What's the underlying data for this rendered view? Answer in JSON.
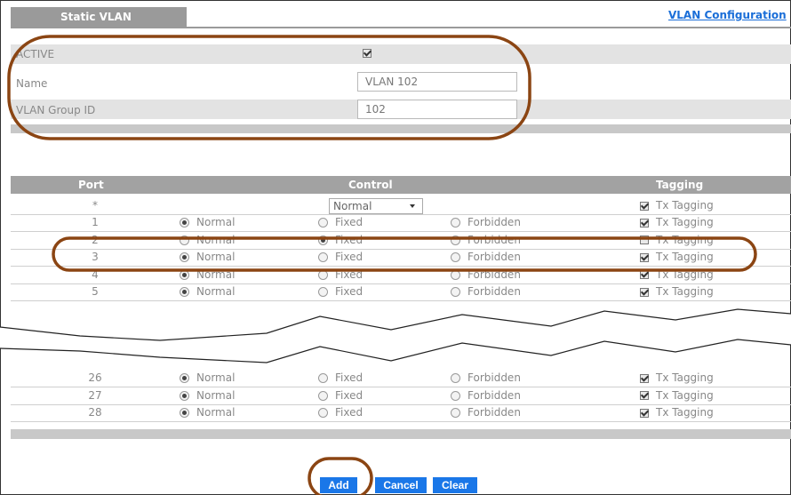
{
  "header": {
    "tab_title": "Static VLAN",
    "link_text": "VLAN Configuration"
  },
  "form": {
    "active_label": "ACTIVE",
    "active_checked": true,
    "name_label": "Name",
    "name_value": "VLAN 102",
    "group_id_label": "VLAN Group ID",
    "group_id_value": "102"
  },
  "table": {
    "col_port": "Port",
    "col_control": "Control",
    "col_tagging": "Tagging",
    "all_row": {
      "port": "*",
      "control_select": "Normal",
      "tagging_label": "Tx Tagging",
      "tagging_checked": true
    },
    "option_labels": {
      "normal": "Normal",
      "fixed": "Fixed",
      "forbidden": "Forbidden",
      "tagging": "Tx Tagging"
    },
    "rows": [
      {
        "port": "1",
        "control": "normal",
        "tx_tagging": true
      },
      {
        "port": "2",
        "control": "fixed",
        "tx_tagging": false
      },
      {
        "port": "3",
        "control": "normal",
        "tx_tagging": true
      },
      {
        "port": "4",
        "control": "normal",
        "tx_tagging": true
      },
      {
        "port": "5",
        "control": "normal",
        "tx_tagging": true
      },
      {
        "port": "26",
        "control": "normal",
        "tx_tagging": true
      },
      {
        "port": "27",
        "control": "normal",
        "tx_tagging": true
      },
      {
        "port": "28",
        "control": "normal",
        "tx_tagging": true
      }
    ]
  },
  "buttons": {
    "add": "Add",
    "cancel": "Cancel",
    "clear": "Clear"
  },
  "colors": {
    "accent": "#1a77e8",
    "annotation": "#8b4513",
    "header_gray": "#9a9a9a"
  }
}
